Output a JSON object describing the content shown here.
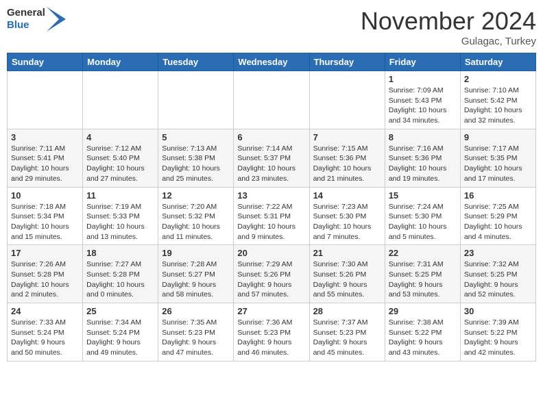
{
  "header": {
    "logo_general": "General",
    "logo_blue": "Blue",
    "month_title": "November 2024",
    "location": "Gulagac, Turkey"
  },
  "weekdays": [
    "Sunday",
    "Monday",
    "Tuesday",
    "Wednesday",
    "Thursday",
    "Friday",
    "Saturday"
  ],
  "weeks": [
    [
      {
        "day": "",
        "info": ""
      },
      {
        "day": "",
        "info": ""
      },
      {
        "day": "",
        "info": ""
      },
      {
        "day": "",
        "info": ""
      },
      {
        "day": "",
        "info": ""
      },
      {
        "day": "1",
        "info": "Sunrise: 7:09 AM\nSunset: 5:43 PM\nDaylight: 10 hours\nand 34 minutes."
      },
      {
        "day": "2",
        "info": "Sunrise: 7:10 AM\nSunset: 5:42 PM\nDaylight: 10 hours\nand 32 minutes."
      }
    ],
    [
      {
        "day": "3",
        "info": "Sunrise: 7:11 AM\nSunset: 5:41 PM\nDaylight: 10 hours\nand 29 minutes."
      },
      {
        "day": "4",
        "info": "Sunrise: 7:12 AM\nSunset: 5:40 PM\nDaylight: 10 hours\nand 27 minutes."
      },
      {
        "day": "5",
        "info": "Sunrise: 7:13 AM\nSunset: 5:38 PM\nDaylight: 10 hours\nand 25 minutes."
      },
      {
        "day": "6",
        "info": "Sunrise: 7:14 AM\nSunset: 5:37 PM\nDaylight: 10 hours\nand 23 minutes."
      },
      {
        "day": "7",
        "info": "Sunrise: 7:15 AM\nSunset: 5:36 PM\nDaylight: 10 hours\nand 21 minutes."
      },
      {
        "day": "8",
        "info": "Sunrise: 7:16 AM\nSunset: 5:36 PM\nDaylight: 10 hours\nand 19 minutes."
      },
      {
        "day": "9",
        "info": "Sunrise: 7:17 AM\nSunset: 5:35 PM\nDaylight: 10 hours\nand 17 minutes."
      }
    ],
    [
      {
        "day": "10",
        "info": "Sunrise: 7:18 AM\nSunset: 5:34 PM\nDaylight: 10 hours\nand 15 minutes."
      },
      {
        "day": "11",
        "info": "Sunrise: 7:19 AM\nSunset: 5:33 PM\nDaylight: 10 hours\nand 13 minutes."
      },
      {
        "day": "12",
        "info": "Sunrise: 7:20 AM\nSunset: 5:32 PM\nDaylight: 10 hours\nand 11 minutes."
      },
      {
        "day": "13",
        "info": "Sunrise: 7:22 AM\nSunset: 5:31 PM\nDaylight: 10 hours\nand 9 minutes."
      },
      {
        "day": "14",
        "info": "Sunrise: 7:23 AM\nSunset: 5:30 PM\nDaylight: 10 hours\nand 7 minutes."
      },
      {
        "day": "15",
        "info": "Sunrise: 7:24 AM\nSunset: 5:30 PM\nDaylight: 10 hours\nand 5 minutes."
      },
      {
        "day": "16",
        "info": "Sunrise: 7:25 AM\nSunset: 5:29 PM\nDaylight: 10 hours\nand 4 minutes."
      }
    ],
    [
      {
        "day": "17",
        "info": "Sunrise: 7:26 AM\nSunset: 5:28 PM\nDaylight: 10 hours\nand 2 minutes."
      },
      {
        "day": "18",
        "info": "Sunrise: 7:27 AM\nSunset: 5:28 PM\nDaylight: 10 hours\nand 0 minutes."
      },
      {
        "day": "19",
        "info": "Sunrise: 7:28 AM\nSunset: 5:27 PM\nDaylight: 9 hours\nand 58 minutes."
      },
      {
        "day": "20",
        "info": "Sunrise: 7:29 AM\nSunset: 5:26 PM\nDaylight: 9 hours\nand 57 minutes."
      },
      {
        "day": "21",
        "info": "Sunrise: 7:30 AM\nSunset: 5:26 PM\nDaylight: 9 hours\nand 55 minutes."
      },
      {
        "day": "22",
        "info": "Sunrise: 7:31 AM\nSunset: 5:25 PM\nDaylight: 9 hours\nand 53 minutes."
      },
      {
        "day": "23",
        "info": "Sunrise: 7:32 AM\nSunset: 5:25 PM\nDaylight: 9 hours\nand 52 minutes."
      }
    ],
    [
      {
        "day": "24",
        "info": "Sunrise: 7:33 AM\nSunset: 5:24 PM\nDaylight: 9 hours\nand 50 minutes."
      },
      {
        "day": "25",
        "info": "Sunrise: 7:34 AM\nSunset: 5:24 PM\nDaylight: 9 hours\nand 49 minutes."
      },
      {
        "day": "26",
        "info": "Sunrise: 7:35 AM\nSunset: 5:23 PM\nDaylight: 9 hours\nand 47 minutes."
      },
      {
        "day": "27",
        "info": "Sunrise: 7:36 AM\nSunset: 5:23 PM\nDaylight: 9 hours\nand 46 minutes."
      },
      {
        "day": "28",
        "info": "Sunrise: 7:37 AM\nSunset: 5:23 PM\nDaylight: 9 hours\nand 45 minutes."
      },
      {
        "day": "29",
        "info": "Sunrise: 7:38 AM\nSunset: 5:22 PM\nDaylight: 9 hours\nand 43 minutes."
      },
      {
        "day": "30",
        "info": "Sunrise: 7:39 AM\nSunset: 5:22 PM\nDaylight: 9 hours\nand 42 minutes."
      }
    ]
  ]
}
